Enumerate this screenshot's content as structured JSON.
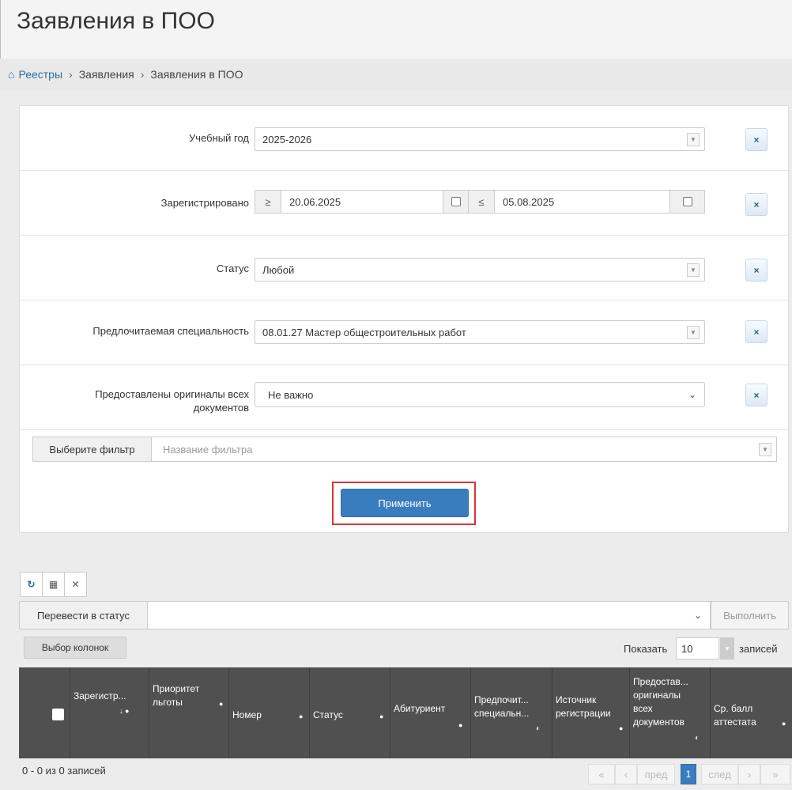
{
  "page_title": "Заявления в ПОО",
  "breadcrumb": {
    "home_icon": "home-icon",
    "items": [
      "Реестры",
      "Заявления",
      "Заявления в ПОО"
    ],
    "separator": "›"
  },
  "filters": {
    "academic_year": {
      "label": "Учебный год",
      "value": "2025-2026"
    },
    "registered": {
      "label": "Зарегистрировано",
      "from_op": "≥",
      "from_value": "20.06.2025",
      "to_op": "≤",
      "to_value": "05.08.2025"
    },
    "status": {
      "label": "Статус",
      "value": "Любой"
    },
    "specialty": {
      "label": "Предлочитаемая специальность",
      "value": "08.01.27 Мастер общестроительных работ"
    },
    "originals": {
      "label_line1": "Предоставлены оригиналы всех",
      "label_line2": "документов",
      "value": "Не важно"
    },
    "clear_label": "×",
    "saved_filter": {
      "label": "Выберите фильтр",
      "placeholder": "Название фильтра"
    },
    "apply_label": "Применить",
    "accent_color": "#3a7dbf",
    "highlight_color": "#d93434"
  },
  "toolbar": {
    "refresh_icon": "refresh-icon",
    "grid_icon": "grid-icon",
    "close_icon": "close-icon",
    "refresh_glyph": "↻",
    "grid_glyph": "▦",
    "close_glyph": "✕"
  },
  "bulk_action": {
    "label": "Перевести в статус",
    "execute_label": "Выполнить"
  },
  "table_controls": {
    "columns_label": "Выбор колонок",
    "show_label": "Показать",
    "page_size": "10",
    "records_label": "записей"
  },
  "table": {
    "columns": [
      {
        "line1": "Зарегистр...",
        "line2": ""
      },
      {
        "line1": "Приоритет",
        "line2": "льготы"
      },
      {
        "line1": "Номер",
        "line2": ""
      },
      {
        "line1": "Статус",
        "line2": ""
      },
      {
        "line1": "Абитуриент",
        "line2": ""
      },
      {
        "line1": "Предпочит...",
        "line2": "специальн..."
      },
      {
        "line1": "Источник",
        "line2": "регистрации"
      },
      {
        "line1": "Предостав...",
        "line2": "оригиналы",
        "line3": "всех",
        "line4": "документов"
      },
      {
        "line1": "Ср. балл",
        "line2": "аттестата"
      }
    ],
    "header_color": "#505050"
  },
  "footer": {
    "info": "0 - 0 из 0 записей",
    "first": "«",
    "prev": "пред",
    "prev_arrow": "‹",
    "current_page": "1",
    "next": "след",
    "next_arrow": "›",
    "last": "»"
  }
}
